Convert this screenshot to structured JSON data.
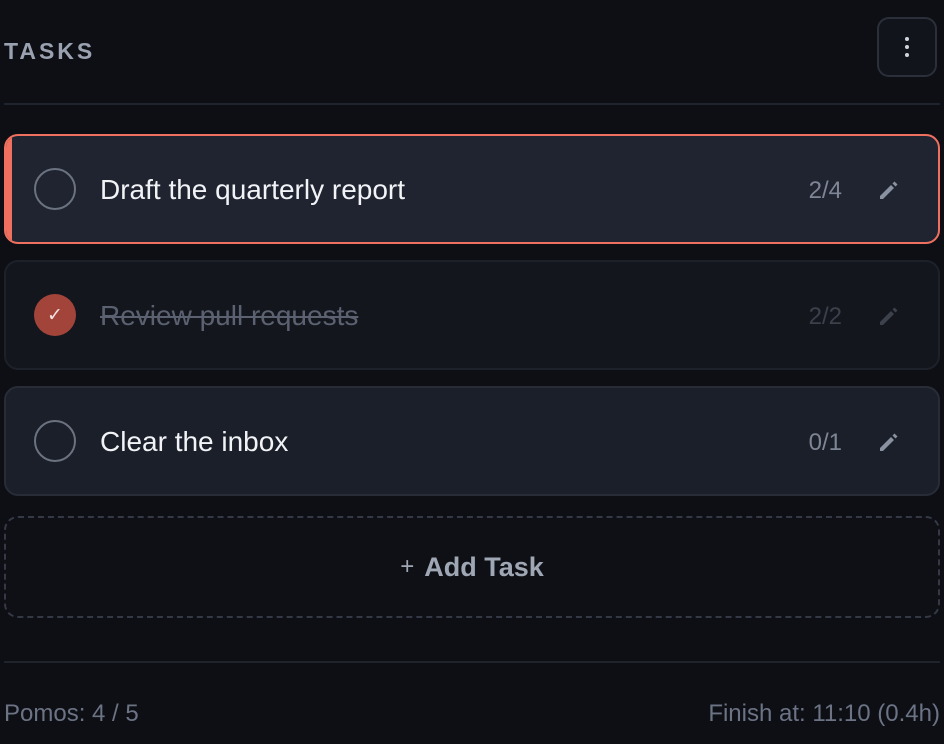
{
  "header": {
    "title": "TASKS",
    "menu_icon": "more-vertical-icon"
  },
  "tasks": [
    {
      "title": "Draft the quarterly report",
      "count": "2/4",
      "done": false,
      "active": true,
      "edit_icon": "pencil-icon"
    },
    {
      "title": "Review pull requests",
      "count": "2/2",
      "done": true,
      "check_glyph": "✓",
      "active": false,
      "edit_icon": "pencil-icon"
    },
    {
      "title": "Clear the inbox",
      "count": "0/1",
      "done": false,
      "active": false,
      "edit_icon": "pencil-icon"
    }
  ],
  "add_task": {
    "plus": "+",
    "label": "Add Task"
  },
  "footer": {
    "pomos": "Pomos: 4 / 5",
    "finish": "Finish at: 11:10 (0.4h)"
  },
  "colors": {
    "accent": "#f0705f",
    "done_check": "#a3443b",
    "background": "#0d0f14"
  }
}
